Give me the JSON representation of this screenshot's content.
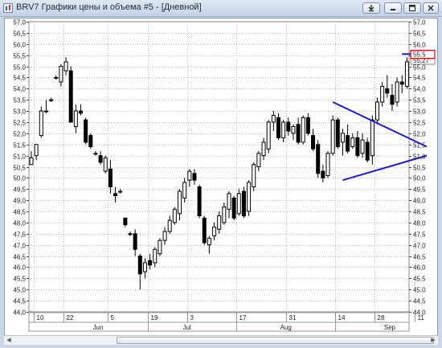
{
  "window": {
    "title": "BRV7 Графики цены и объема #5 - [Дневной]",
    "buttons": [
      "pin-button",
      "minimize-button",
      "maximize-button",
      "close-button"
    ]
  },
  "chart_data": {
    "type": "candlestick",
    "ylim": [
      44.0,
      57.0
    ],
    "y_ticks": [
      "44,0",
      "44,5",
      "45,0",
      "45,5",
      "46,0",
      "46,5",
      "47,0",
      "47,5",
      "48,0",
      "48,5",
      "49,0",
      "49,5",
      "50,0",
      "50,5",
      "51,0",
      "51,5",
      "52,0",
      "52,5",
      "53,0",
      "53,5",
      "54,0",
      "54,5",
      "55,0",
      "55,5",
      "56,0",
      "56,5",
      "57,0"
    ],
    "x_day_labels": [
      "10",
      "22",
      "5",
      "19",
      "3",
      "17",
      "31",
      "14",
      "28",
      "11"
    ],
    "x_month_labels": [
      "Jun",
      "Jul",
      "Aug",
      "Sep"
    ],
    "grid": true,
    "current_price_label": "55,27",
    "marked_level_label": "55,5",
    "colors": {
      "up": "#ffffff",
      "down": "#000000",
      "annotation": "#1c1ccc",
      "marker": "#cc0000"
    },
    "candles": [
      [
        50.6,
        51.2,
        50.6,
        50.9
      ],
      [
        51.0,
        51.4,
        50.8,
        51.5
      ],
      [
        51.9,
        53.2,
        51.8,
        53.0
      ],
      [
        53.0,
        53.5,
        52.9,
        53.0
      ],
      [
        53.5,
        53.6,
        53.4,
        53.5
      ],
      [
        54.5,
        54.6,
        54.4,
        54.5
      ],
      [
        54.3,
        55.1,
        54.1,
        55.0
      ],
      [
        54.8,
        55.4,
        54.6,
        55.2
      ],
      [
        54.8,
        55.0,
        52.5,
        52.5
      ],
      [
        52.3,
        53.3,
        52.0,
        53.0
      ],
      [
        53.0,
        53.3,
        52.8,
        52.9
      ],
      [
        52.6,
        52.7,
        51.5,
        51.6
      ],
      [
        51.9,
        52.0,
        51.3,
        51.4
      ],
      [
        51.1,
        51.2,
        51.0,
        51.1
      ],
      [
        51.0,
        51.2,
        50.6,
        50.7
      ],
      [
        50.3,
        51.0,
        50.2,
        50.9
      ],
      [
        50.4,
        50.8,
        49.3,
        49.6
      ],
      [
        49.3,
        49.6,
        48.9,
        49.2
      ],
      [
        49.4,
        49.5,
        49.3,
        49.4
      ],
      [
        48.2,
        48.2,
        47.8,
        47.9
      ],
      [
        47.5,
        47.6,
        47.4,
        47.5
      ],
      [
        47.5,
        47.7,
        46.5,
        46.8
      ],
      [
        46.5,
        46.6,
        45.0,
        45.7
      ],
      [
        45.8,
        46.4,
        45.5,
        46.2
      ],
      [
        46.3,
        46.6,
        45.9,
        46.1
      ],
      [
        46.2,
        46.9,
        46.0,
        46.8
      ],
      [
        46.6,
        47.3,
        46.5,
        47.2
      ],
      [
        47.2,
        47.8,
        47.0,
        47.6
      ],
      [
        47.6,
        48.3,
        47.5,
        48.1
      ],
      [
        48.0,
        48.7,
        47.9,
        48.6
      ],
      [
        48.4,
        49.5,
        48.1,
        49.4
      ],
      [
        49.1,
        50.0,
        48.9,
        49.8
      ],
      [
        49.9,
        50.4,
        49.6,
        50.3
      ],
      [
        50.2,
        50.4,
        49.7,
        49.9
      ],
      [
        49.6,
        49.7,
        48.2,
        48.3
      ],
      [
        48.2,
        48.3,
        47.0,
        47.1
      ],
      [
        47.0,
        47.4,
        46.6,
        47.3
      ],
      [
        47.4,
        48.0,
        47.2,
        47.8
      ],
      [
        47.7,
        48.5,
        47.5,
        48.3
      ],
      [
        48.0,
        48.9,
        47.9,
        48.7
      ],
      [
        48.6,
        49.4,
        48.2,
        49.3
      ],
      [
        49.1,
        49.2,
        48.1,
        48.2
      ],
      [
        48.4,
        49.5,
        48.3,
        49.3
      ],
      [
        49.4,
        49.6,
        48.2,
        48.3
      ],
      [
        48.5,
        49.9,
        48.3,
        49.8
      ],
      [
        49.6,
        50.7,
        49.4,
        50.6
      ],
      [
        50.5,
        51.2,
        50.3,
        51.1
      ],
      [
        51.0,
        51.8,
        50.8,
        51.6
      ],
      [
        51.3,
        52.6,
        51.1,
        52.5
      ],
      [
        52.5,
        53.0,
        52.1,
        52.8
      ],
      [
        52.7,
        52.9,
        51.7,
        51.8
      ],
      [
        51.8,
        52.6,
        51.6,
        52.5
      ],
      [
        52.5,
        52.7,
        51.9,
        52.1
      ],
      [
        52.0,
        52.4,
        51.7,
        52.3
      ],
      [
        52.4,
        52.7,
        51.5,
        51.6
      ],
      [
        51.6,
        52.8,
        51.5,
        52.7
      ],
      [
        52.7,
        52.9,
        51.9,
        52.0
      ],
      [
        51.9,
        52.2,
        51.2,
        51.3
      ],
      [
        51.5,
        51.7,
        50.0,
        50.2
      ],
      [
        50.3,
        50.6,
        49.8,
        50.0
      ],
      [
        50.1,
        51.2,
        50.0,
        51.1
      ],
      [
        51.1,
        52.8,
        51.0,
        52.6
      ],
      [
        52.6,
        52.7,
        51.3,
        51.4
      ],
      [
        51.6,
        52.2,
        51.0,
        52.0
      ],
      [
        51.9,
        52.4,
        51.1,
        51.2
      ],
      [
        51.4,
        52.0,
        51.3,
        51.8
      ],
      [
        51.8,
        52.1,
        50.9,
        51.0
      ],
      [
        51.1,
        52.0,
        50.9,
        51.7
      ],
      [
        51.6,
        51.8,
        50.7,
        50.8
      ],
      [
        51.0,
        52.8,
        50.6,
        52.6
      ],
      [
        52.6,
        53.6,
        52.4,
        53.4
      ],
      [
        53.4,
        54.3,
        53.2,
        54.1
      ],
      [
        54.0,
        54.6,
        53.6,
        53.8
      ],
      [
        53.7,
        54.2,
        53.0,
        53.3
      ],
      [
        53.4,
        54.5,
        53.2,
        54.3
      ],
      [
        54.3,
        54.6,
        53.8,
        54.2
      ],
      [
        54.1,
        55.4,
        54.0,
        55.2
      ]
    ],
    "annotations": [
      {
        "type": "line",
        "from": [
          61,
          53.4
        ],
        "to": [
          80,
          51.4
        ]
      },
      {
        "type": "line",
        "from": [
          63,
          49.9
        ],
        "to": [
          80,
          51.0
        ]
      },
      {
        "type": "line",
        "from": [
          75,
          55.55
        ],
        "to": [
          80,
          55.55
        ]
      }
    ]
  }
}
